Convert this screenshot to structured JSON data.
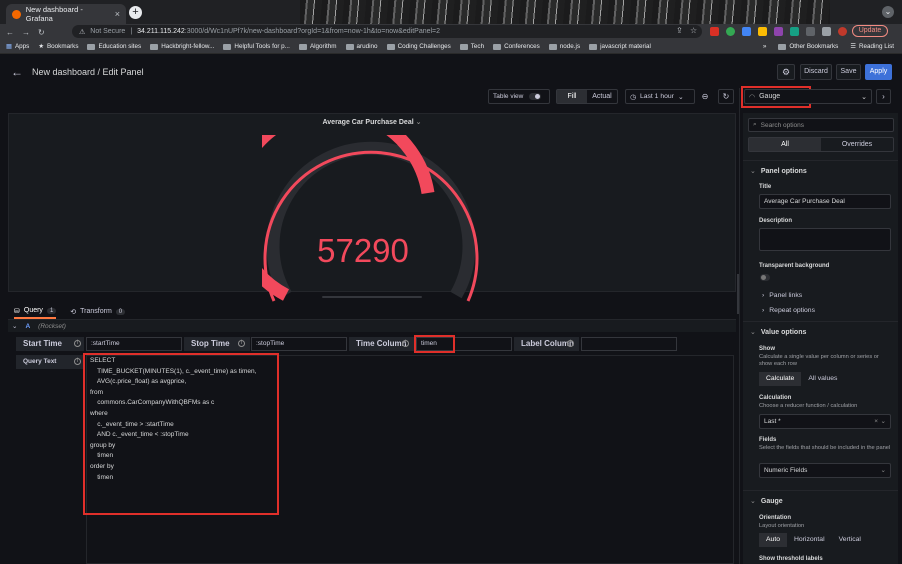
{
  "browser": {
    "tab_title": "New dashboard - Grafana",
    "not_secure": "Not Secure",
    "host": "34.211.115.242",
    "path": ":3000/d/Wc1nUPf7k/new-dashboard?orgId=1&from=now-1h&to=now&editPanel=2",
    "update_label": "Update",
    "bookmarks": [
      "Apps",
      "Bookmarks",
      "Education sites",
      "Hackbright-fellow...",
      "Helpful Tools for p...",
      "Algorithm",
      "arudino",
      "Coding Challenges",
      "Tech",
      "Conferences",
      "node.js",
      "javascript material"
    ],
    "other_bookmarks": "Other Bookmarks",
    "reading_list": "Reading List"
  },
  "header": {
    "title": "New dashboard / Edit Panel",
    "discard": "Discard",
    "save": "Save",
    "apply": "Apply"
  },
  "panel_toolbar": {
    "table_view": "Table view",
    "fill": "Fill",
    "actual": "Actual",
    "time_range": "Last 1 hour"
  },
  "panel": {
    "title": "Average Car Purchase Deal",
    "value": "57290"
  },
  "query": {
    "tabs": [
      {
        "label": "Query",
        "count": "1"
      },
      {
        "label": "Transform",
        "count": "0"
      }
    ],
    "ref": "A",
    "datasource": "(Rockset)",
    "start_time_label": "Start Time",
    "start_time_value": ":startTime",
    "stop_time_label": "Stop Time",
    "stop_time_value": ":stopTime",
    "time_column_label": "Time Column",
    "time_column_value": "timen",
    "label_column_label": "Label Column",
    "label_column_value": "",
    "query_text_label": "Query Text",
    "sql": "SELECT\n    TIME_BUCKET(MINUTES(1), c._event_time) as timen,\n    AVG(c.price_float) as avgprice,\nfrom\n    commons.CarCompanyWithQBFMs as c\nwhere\n    c._event_time > :startTime\n    AND c._event_time < :stopTime\ngroup by\n    timen\norder by\n    timen"
  },
  "options": {
    "viz_type": "Gauge",
    "search_placeholder": "Search options",
    "tab_all": "All",
    "tab_overrides": "Overrides",
    "panel_options_h": "Panel options",
    "title_label": "Title",
    "title_value": "Average Car Purchase Deal",
    "description_label": "Description",
    "transparent_label": "Transparent background",
    "panel_links": "Panel links",
    "repeat_options": "Repeat options",
    "value_options_h": "Value options",
    "show_label": "Show",
    "show_desc": "Calculate a single value per column or series or show each row",
    "calculate": "Calculate",
    "all_values": "All values",
    "calculation_label": "Calculation",
    "calculation_desc": "Choose a reducer function / calculation",
    "calculation_value": "Last *",
    "fields_label": "Fields",
    "fields_desc": "Select the fields that should be included in the panel",
    "fields_value": "Numeric Fields",
    "gauge_h": "Gauge",
    "orientation_label": "Orientation",
    "orientation_desc": "Layout orientation",
    "orient_auto": "Auto",
    "orient_horizontal": "Horizontal",
    "orient_vertical": "Vertical",
    "threshold_labels": "Show threshold labels"
  },
  "colors": {
    "gauge_red": "#f2495c",
    "accent_orange": "#ff7941",
    "apply_blue": "#3d71d9",
    "highlight_box": "#e02f2a"
  }
}
